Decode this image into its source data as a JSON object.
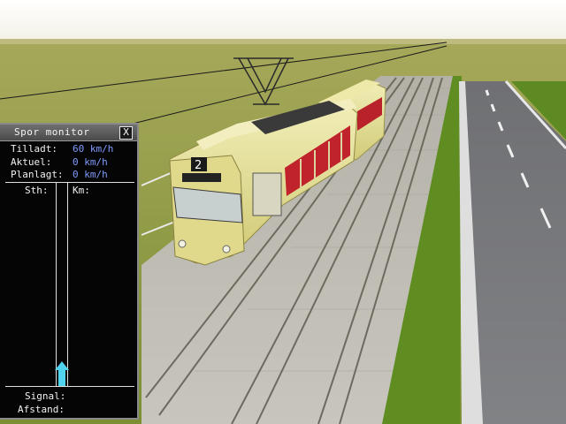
{
  "monitor": {
    "title": "Spor monitor",
    "close_label": "X",
    "rows": [
      {
        "label": "Tilladt:",
        "value": "60 km/h"
      },
      {
        "label": "Aktuel:",
        "value": "0 km/h"
      },
      {
        "label": "Planlagt:",
        "value": "0 km/h"
      }
    ],
    "col_sth": "Sth:",
    "col_km": "Km:",
    "signal_label": "Signal:",
    "afstand_label": "Afstand:"
  },
  "tram": {
    "line_number": "2"
  },
  "colors": {
    "sky": "#ffffff",
    "grass": "#8d9b3c",
    "tram_body": "#e8e4a0",
    "monitor_value": "#7f9cff",
    "speed_marker": "#4fd3ef"
  }
}
